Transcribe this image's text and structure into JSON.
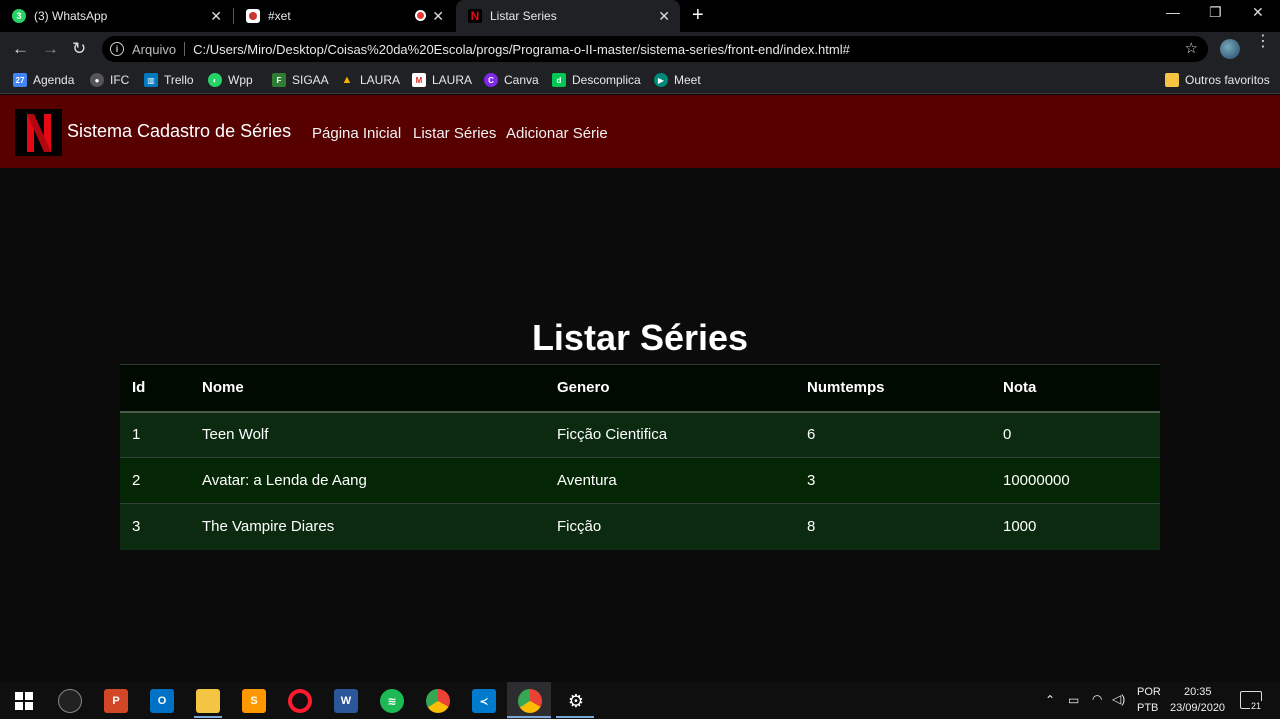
{
  "browser": {
    "tabs": [
      {
        "title": "(3) WhatsApp",
        "favicon": "whatsapp-icon",
        "color": "#25d366"
      },
      {
        "title": "#xet",
        "favicon": "xet-icon",
        "color": "#c33"
      },
      {
        "title": "Listar Series",
        "favicon": "netflix-icon",
        "color": "#e50914"
      }
    ],
    "address": {
      "scheme_label": "Arquivo",
      "url": "C:/Users/Miro/Desktop/Coisas%20da%20Escola/progs/Programa-o-II-master/sistema-series/front-end/index.html#"
    },
    "bookmarks": [
      {
        "label": "Agenda",
        "icon": "calendar-icon",
        "color": "#4285f4",
        "glyph": "27"
      },
      {
        "label": "IFC",
        "icon": "globe-icon",
        "color": "#555",
        "glyph": "●"
      },
      {
        "label": "Trello",
        "icon": "trello-icon",
        "color": "#0079bf",
        "glyph": "▥"
      },
      {
        "label": "Wpp",
        "icon": "whatsapp-icon",
        "color": "#25d366",
        "glyph": "◐"
      },
      {
        "label": "SIGAA",
        "icon": "sigaa-icon",
        "color": "#2e7d32",
        "glyph": "F"
      },
      {
        "label": "LAURA",
        "icon": "drive-icon",
        "color": "#f4b400",
        "glyph": "▲"
      },
      {
        "label": "LAURA",
        "icon": "gmail-icon",
        "color": "#d93025",
        "glyph": "M"
      },
      {
        "label": "Canva",
        "icon": "canva-icon",
        "color": "#7d2ae8",
        "glyph": "C"
      },
      {
        "label": "Descomplica",
        "icon": "descomplica-icon",
        "color": "#00c853",
        "glyph": "d"
      },
      {
        "label": "Meet",
        "icon": "meet-icon",
        "color": "#00897b",
        "glyph": "▶"
      }
    ],
    "other_bookmarks": "Outros favoritos"
  },
  "app": {
    "brand": "Sistema Cadastro de Séries",
    "logo_glyph": "N",
    "nav": [
      "Página Inicial",
      "Listar Séries",
      "Adicionar Série"
    ],
    "page_title": "Listar Séries",
    "table": {
      "headers": [
        "Id",
        "Nome",
        "Genero",
        "Numtemps",
        "Nota"
      ],
      "rows": [
        [
          "1",
          "Teen Wolf",
          "Ficção Cientifica",
          "6",
          "0"
        ],
        [
          "2",
          "Avatar: a Lenda de Aang",
          "Aventura",
          "3",
          "10000000"
        ],
        [
          "3",
          "The Vampire Diares",
          "Ficção",
          "8",
          "1000"
        ]
      ]
    }
  },
  "taskbar": {
    "lang": "POR",
    "layout": "PTB",
    "time": "20:35",
    "date": "23/09/2020",
    "notifications": "21"
  }
}
